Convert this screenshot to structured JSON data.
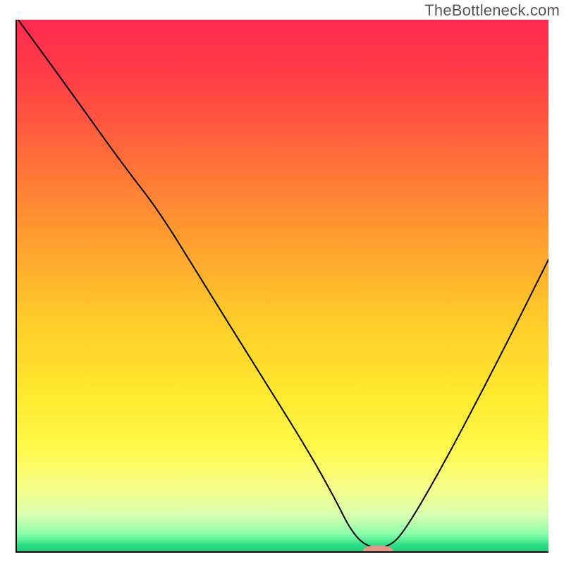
{
  "watermark": "TheBottleneck.com",
  "chart_data": {
    "type": "line",
    "title": "",
    "xlabel": "",
    "ylabel": "",
    "xlim": [
      0,
      100
    ],
    "ylim": [
      0,
      100
    ],
    "series": [
      {
        "name": "bottleneck-curve",
        "x": [
          0.5,
          10,
          20,
          27,
          35,
          45,
          55,
          60,
          63,
          66,
          70,
          73,
          80,
          90,
          100
        ],
        "y": [
          100,
          87,
          73,
          64,
          51,
          35,
          19,
          10,
          4,
          1,
          1,
          4,
          16,
          35,
          55
        ],
        "stroke": "#000000",
        "stroke_width": 2
      }
    ],
    "marker": {
      "name": "sweet-spot-marker",
      "x": 68,
      "y": 0.5,
      "rx": 2.8,
      "ry": 0.9,
      "fill": "#e8948a"
    },
    "background_gradient": {
      "type": "vertical",
      "stops": [
        {
          "offset": 0.0,
          "color": "#ff2a4f"
        },
        {
          "offset": 0.1,
          "color": "#ff3b47"
        },
        {
          "offset": 0.25,
          "color": "#ff6a3a"
        },
        {
          "offset": 0.4,
          "color": "#ff9a30"
        },
        {
          "offset": 0.55,
          "color": "#ffc82a"
        },
        {
          "offset": 0.7,
          "color": "#ffe92e"
        },
        {
          "offset": 0.8,
          "color": "#fff84a"
        },
        {
          "offset": 0.88,
          "color": "#f6ff8a"
        },
        {
          "offset": 0.93,
          "color": "#d6ffb0"
        },
        {
          "offset": 0.965,
          "color": "#8affad"
        },
        {
          "offset": 0.985,
          "color": "#2fe085"
        },
        {
          "offset": 1.0,
          "color": "#17c96f"
        }
      ]
    },
    "axes": {
      "stroke": "#000000",
      "stroke_width": 2
    }
  }
}
